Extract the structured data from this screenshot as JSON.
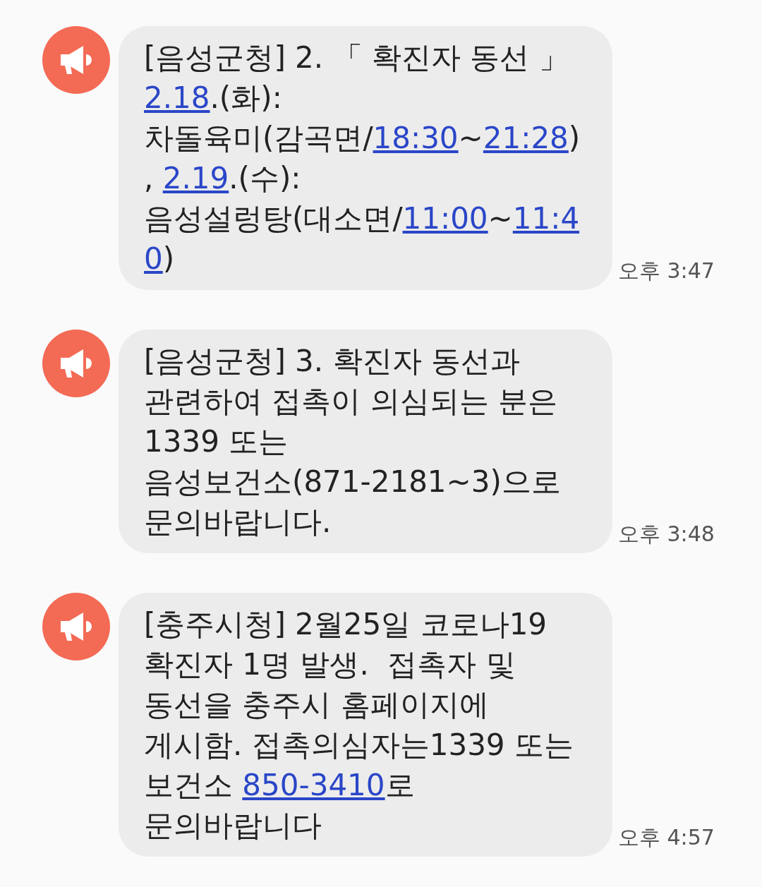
{
  "messages": [
    {
      "time": "오후 3:47",
      "lines": [
        [
          {
            "text": "[음성군청] 2. 「 확진자 동선 」",
            "link": false
          }
        ],
        [
          {
            "text": "2.18",
            "link": true
          },
          {
            "text": ".(화):",
            "link": false
          }
        ],
        [
          {
            "text": "차돌육미(감곡면/",
            "link": false
          },
          {
            "text": "18:30",
            "link": true
          },
          {
            "text": "~",
            "link": false
          },
          {
            "text": "21:28",
            "link": true
          },
          {
            "text": ")",
            "link": false
          }
        ],
        [
          {
            "text": ", ",
            "link": false
          },
          {
            "text": "2.19",
            "link": true
          },
          {
            "text": ".(수):",
            "link": false
          }
        ],
        [
          {
            "text": "음성설렁탕(대소면/",
            "link": false
          },
          {
            "text": "11:00",
            "link": true
          },
          {
            "text": "~",
            "link": false
          },
          {
            "text": "11:4",
            "link": true
          }
        ],
        [
          {
            "text": "0",
            "link": true
          },
          {
            "text": ")",
            "link": false
          }
        ]
      ]
    },
    {
      "time": "오후 3:48",
      "lines": [
        [
          {
            "text": "[음성군청] 3. 확진자 동선과",
            "link": false
          }
        ],
        [
          {
            "text": "관련하여 접촉이 의심되는 분은",
            "link": false
          }
        ],
        [
          {
            "text": "1339 또는",
            "link": false
          }
        ],
        [
          {
            "text": "음성보건소(871-2181~3)으로",
            "link": false
          }
        ],
        [
          {
            "text": "문의바랍니다.",
            "link": false
          }
        ]
      ]
    },
    {
      "time": "오후 4:57",
      "lines": [
        [
          {
            "text": "[충주시청] 2월25일 코로나19",
            "link": false
          }
        ],
        [
          {
            "text": "확진자 1명 발생.  접촉자 및",
            "link": false
          }
        ],
        [
          {
            "text": "동선을 충주시 홈페이지에",
            "link": false
          }
        ],
        [
          {
            "text": "게시함. 접촉의심자는1339 또는",
            "link": false
          }
        ],
        [
          {
            "text": "보건소 ",
            "link": false
          },
          {
            "text": "850-3410",
            "link": true
          },
          {
            "text": "로",
            "link": false
          }
        ],
        [
          {
            "text": "문의바랍니다",
            "link": false
          }
        ]
      ]
    }
  ]
}
